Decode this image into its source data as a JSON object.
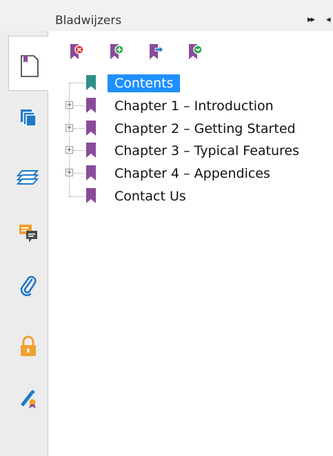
{
  "header": {
    "title": "Bladwijzers",
    "collapse_glyph": "▸▸",
    "more_glyph": "◂"
  },
  "rail": {
    "tabs": [
      {
        "id": "bookmarks",
        "icon": "page-icon",
        "active": true
      },
      {
        "id": "pages",
        "icon": "pages-icon"
      },
      {
        "id": "layers",
        "icon": "layers-icon"
      },
      {
        "id": "comments",
        "icon": "comments-icon"
      },
      {
        "id": "attachments",
        "icon": "paperclip-icon"
      },
      {
        "id": "security",
        "icon": "lock-icon"
      },
      {
        "id": "signatures",
        "icon": "signature-icon"
      }
    ]
  },
  "toolbar": {
    "buttons": [
      {
        "id": "delete",
        "icon": "delete-bookmark-icon"
      },
      {
        "id": "add",
        "icon": "add-bookmark-icon"
      },
      {
        "id": "move",
        "icon": "move-bookmark-icon"
      },
      {
        "id": "expand",
        "icon": "expand-bookmark-icon"
      }
    ]
  },
  "tree": {
    "items": [
      {
        "label": "Contents",
        "selected": true,
        "expandable": false
      },
      {
        "label": "Chapter 1 – Introduction",
        "selected": false,
        "expandable": true
      },
      {
        "label": "Chapter 2 – Getting Started",
        "selected": false,
        "expandable": true
      },
      {
        "label": "Chapter 3 – Typical Features",
        "selected": false,
        "expandable": true
      },
      {
        "label": "Chapter 4 – Appendices",
        "selected": false,
        "expandable": true
      },
      {
        "label": "Contact Us",
        "selected": false,
        "expandable": false
      }
    ]
  },
  "colors": {
    "bookmark": "#8a4b9a",
    "bookmark_selected": "#2f8f8a",
    "selection": "#1e90ff",
    "rail_blue": "#1f78c8",
    "rail_orange": "#f0a030"
  }
}
